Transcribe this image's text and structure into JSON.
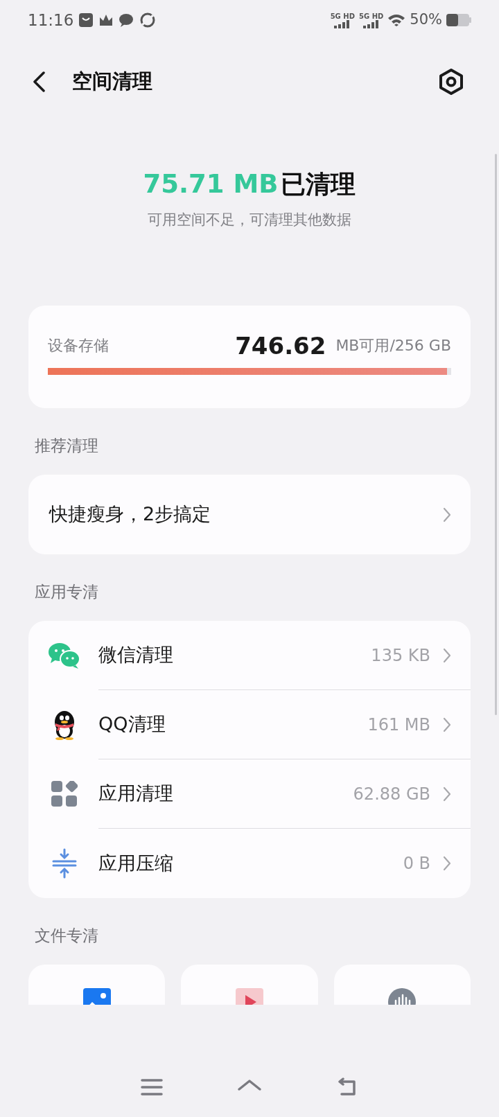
{
  "status_bar": {
    "time": "11:16",
    "networks": [
      "5G HD",
      "5G HD"
    ],
    "battery": "50%"
  },
  "header": {
    "title": "空间清理"
  },
  "summary": {
    "amount": "75.71 MB",
    "suffix": "已清理",
    "hint": "可用空间不足，可清理其他数据"
  },
  "storage": {
    "label": "设备存储",
    "value": "746.62",
    "unit": "MB可用/256 GB",
    "level": 0.99
  },
  "sections": [
    {
      "title": "推荐清理",
      "items": [
        {
          "kind": "plain",
          "label": "快捷瘦身，2步搞定"
        }
      ]
    },
    {
      "title": "应用专清",
      "items": [
        {
          "kind": "wechat",
          "label": "微信清理",
          "size": "135 KB"
        },
        {
          "kind": "qq",
          "label": "QQ清理",
          "size": "161 MB"
        },
        {
          "kind": "apps",
          "label": "应用清理",
          "size": "62.88 GB"
        },
        {
          "kind": "compress",
          "label": "应用压缩",
          "size": "0 B"
        }
      ]
    }
  ],
  "files": {
    "title": "文件专清",
    "tiles": [
      {
        "kind": "image"
      },
      {
        "kind": "video"
      },
      {
        "kind": "audio"
      }
    ]
  }
}
